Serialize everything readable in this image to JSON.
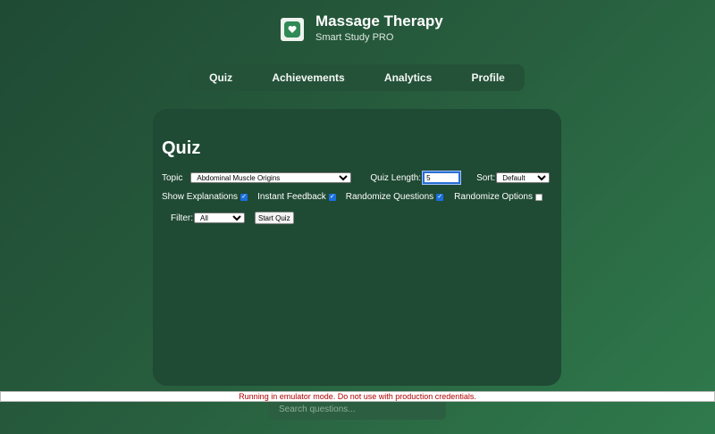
{
  "app": {
    "title": "Massage Therapy",
    "subtitle": "Smart Study PRO"
  },
  "nav": {
    "tabs": [
      "Quiz",
      "Achievements",
      "Analytics",
      "Profile"
    ]
  },
  "quiz": {
    "title": "Quiz",
    "topic_label": "Topic",
    "topic_value": "Abdominal Muscle Origins",
    "length_label": "Quiz Length:",
    "length_value": "5",
    "sort_label": "Sort:",
    "sort_value": "Default",
    "options": [
      {
        "label": "Show Explanations",
        "checked": true
      },
      {
        "label": "Instant Feedback",
        "checked": true
      },
      {
        "label": "Randomize Questions",
        "checked": true
      },
      {
        "label": "Randomize Options",
        "checked": false
      }
    ],
    "filter_label": "Filter:",
    "filter_value": "All",
    "start_button": "Start Quiz"
  },
  "banner": "Running in emulator mode. Do not use with production credentials.",
  "search": {
    "placeholder": "Search questions..."
  },
  "colors": {
    "accent": "#2a6fd6",
    "checkbox": "#1a6fe0",
    "warning_text": "#b00000"
  }
}
